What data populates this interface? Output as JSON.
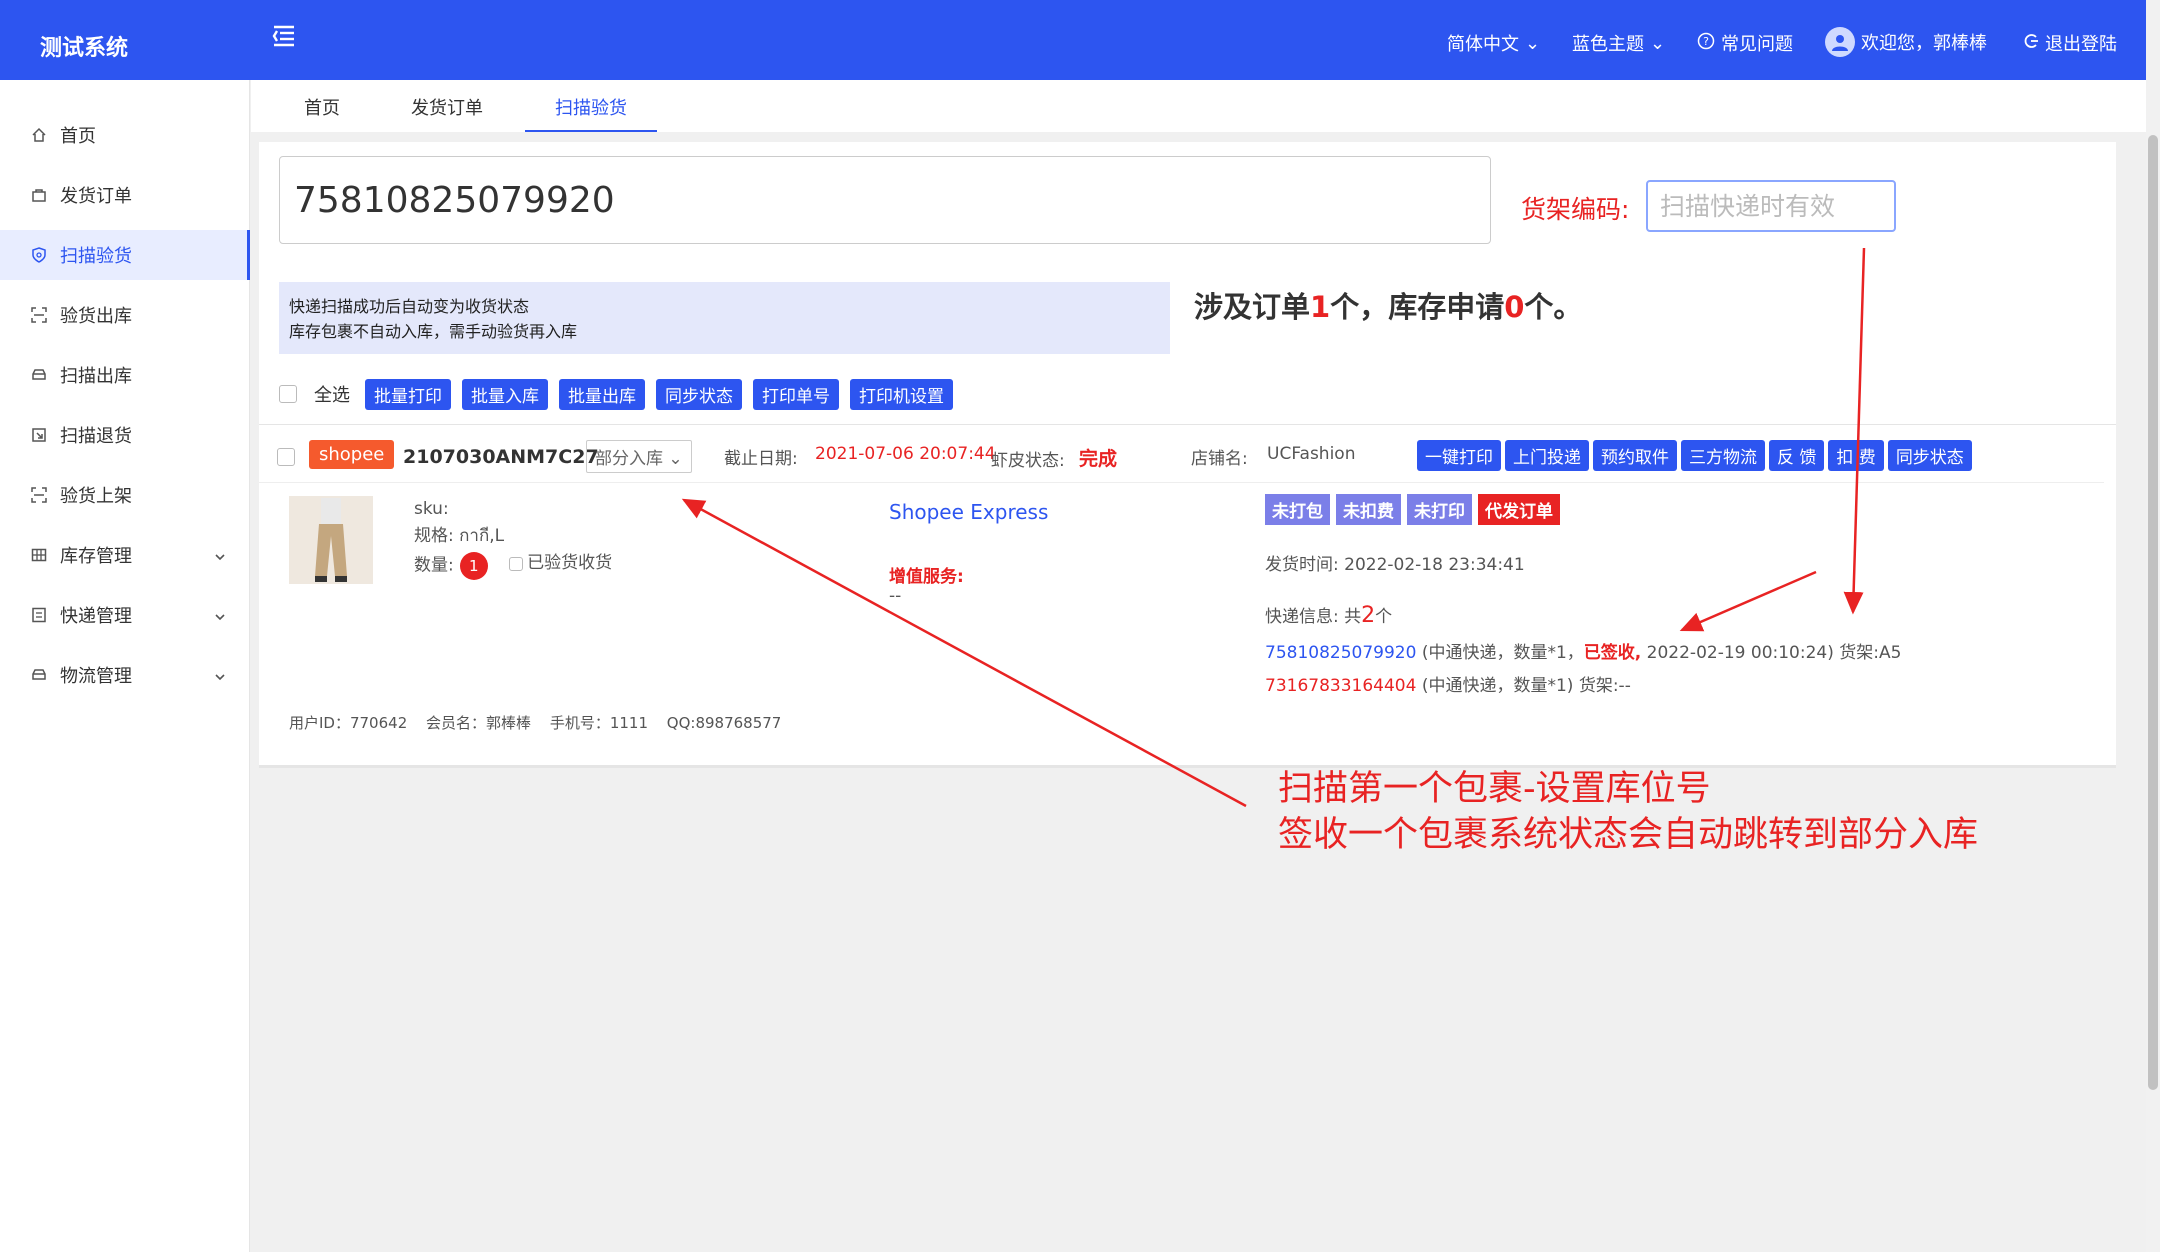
{
  "header": {
    "logo": "测试系统",
    "language": "简体中文",
    "theme": "蓝色主题",
    "faq": "常见问题",
    "welcome": "欢迎您，郭棒棒",
    "logout": "退出登陆"
  },
  "sidebar": {
    "items": [
      {
        "label": "首页",
        "icon": "home-icon"
      },
      {
        "label": "发货订单",
        "icon": "bag-icon"
      },
      {
        "label": "扫描验货",
        "icon": "shield-icon",
        "active": true
      },
      {
        "label": "验货出库",
        "icon": "scan-icon"
      },
      {
        "label": "扫描出库",
        "icon": "car-icon"
      },
      {
        "label": "扫描退货",
        "icon": "return-icon"
      },
      {
        "label": "验货上架",
        "icon": "scan-icon"
      },
      {
        "label": "库存管理",
        "icon": "grid-icon",
        "expandable": true
      },
      {
        "label": "快递管理",
        "icon": "list-icon",
        "expandable": true
      },
      {
        "label": "物流管理",
        "icon": "car-icon",
        "expandable": true
      }
    ]
  },
  "tabs": [
    "首页",
    "发货订单",
    "扫描验货"
  ],
  "scan": {
    "tracking_value": "75810825079920",
    "shelf_label": "货架编码:",
    "shelf_placeholder": "扫描快递时有效"
  },
  "notice": {
    "line1": "快递扫描成功后自动变为收货状态",
    "line2": "库存包裹不自动入库，需手动验货再入库"
  },
  "summary": {
    "prefix": "涉及订单",
    "orders": "1",
    "mid": "个，库存申请",
    "stock": "0",
    "suffix": "个。"
  },
  "toolbar": {
    "select_all": "全选",
    "buttons": [
      "批量打印",
      "批量入库",
      "批量出库",
      "同步状态",
      "打印单号",
      "打印机设置"
    ]
  },
  "order": {
    "shop_tag": "shopee",
    "order_no": "2107030ANM7C27",
    "status": "部分入库",
    "deadline_label": "截止日期:",
    "deadline_value": "2021-07-06 20:07:44",
    "shopee_status_label": "虾皮状态:",
    "shopee_status_value": "完成",
    "store_label": "店铺名:",
    "store_value": "UCFashion",
    "actions": [
      "一键打印",
      "上门投递",
      "预约取件",
      "三方物流",
      "反 馈",
      "扣 费",
      "同步状态"
    ],
    "sku_label": "sku:",
    "spec_label": "规格:",
    "spec_value": "กากี,L",
    "qty_label": "数量:",
    "qty_value": "1",
    "verified_label": "已验货收货",
    "carrier": "Shopee Express",
    "vas_label": "增值服务:",
    "vas_value": "--",
    "status_tags": [
      "未打包",
      "未扣费",
      "未打印",
      "代发订单"
    ],
    "ship_time_label": "发货时间:",
    "ship_time_value": "2022-02-18 23:34:41",
    "express_label": "快递信息:",
    "express_total_prefix": "共",
    "express_total": "2",
    "express_total_suffix": "个",
    "express": [
      {
        "no": "75810825079920",
        "detail": "(中通快递，数量*1，",
        "signed": "已签收,",
        "rest": "2022-02-19 00:10:24) 货架:A5"
      },
      {
        "no": "73167833164404",
        "detail": "(中通快递，数量*1) 货架:--"
      }
    ],
    "user": {
      "id": "用户ID：770642",
      "member": "会员名：郭棒棒",
      "phone": "手机号：1111",
      "qq": "QQ:898768577"
    }
  },
  "annotation": {
    "line1": "扫描第一个包裹-设置库位号",
    "line2": "签收一个包裹系统状态会自动跳转到部分入库"
  },
  "colors": {
    "primary": "#2d55f0",
    "danger": "#e82323",
    "shopee": "#f55a2d",
    "tag_purple": "#7b7fe8"
  }
}
